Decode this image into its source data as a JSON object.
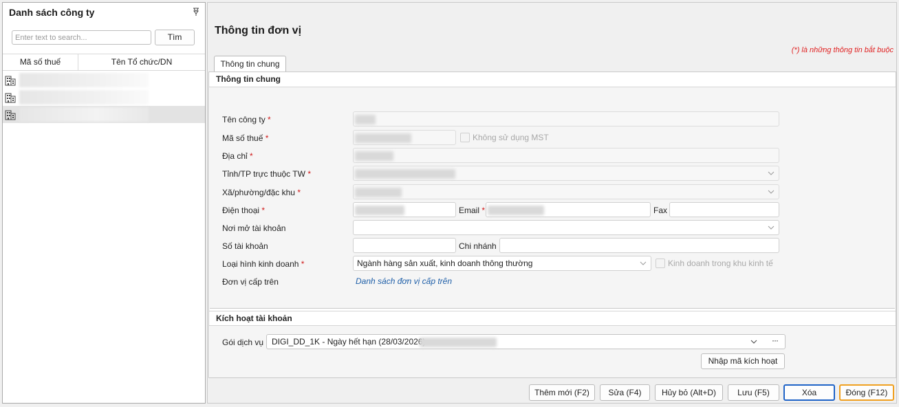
{
  "left_panel": {
    "title": "Danh sách công ty",
    "search": {
      "placeholder": "Enter text to search...",
      "value": ""
    },
    "search_button": "Tìm",
    "columns": [
      "Mã số thuế",
      "Tên Tổ chức/DN"
    ],
    "rows": [
      {
        "icon": "building-icon"
      },
      {
        "icon": "building-icon"
      },
      {
        "icon": "building-icon"
      }
    ]
  },
  "main": {
    "title": "Thông tin đơn vị",
    "required_note": "(*) là những thông tin bắt buộc",
    "tab": "Thông tin chung",
    "section_general": "Thông tin chung",
    "section_activation": "Kích hoạt tài khoản",
    "fields": {
      "company_name": {
        "label": "Tên công ty",
        "required": "*"
      },
      "tax_code": {
        "label": "Mã số thuế",
        "required": "*"
      },
      "no_tax_code": {
        "label": "Không sử dụng MST",
        "checked": false
      },
      "address": {
        "label": "Địa chỉ",
        "required": "*"
      },
      "province": {
        "label": "Tỉnh/TP trực thuộc TW",
        "required": "*"
      },
      "ward": {
        "label": "Xã/phường/đặc khu",
        "required": "*"
      },
      "phone": {
        "label": "Điện thoại",
        "required": "*"
      },
      "email": {
        "label": "Email",
        "required": "*"
      },
      "fax": {
        "label": "Fax",
        "value": ""
      },
      "bank": {
        "label": "Nơi mở tài khoản",
        "value": ""
      },
      "account_no": {
        "label": "Số tài khoản",
        "value": ""
      },
      "branch": {
        "label": "Chi nhánh",
        "value": ""
      },
      "business_type": {
        "label": "Loại hình kinh doanh",
        "required": "*",
        "value": "Ngành hàng sản xuất, kinh doanh thông thường"
      },
      "economic_zone": {
        "label": "Kinh doanh trong khu kinh tế",
        "checked": false
      },
      "parent_unit": {
        "label": "Đơn vị cấp trên",
        "link": "Danh sách đơn vị cấp trên"
      }
    },
    "activation": {
      "package_label": "Gói dịch vụ",
      "package_value": "DIGI_DD_1K - Ngày hết hạn (28/03/2026) -",
      "more_button": "···",
      "activate_button": "Nhập mã kích hoạt"
    }
  },
  "buttons": {
    "add": "Thêm mới (F2)",
    "edit": "Sửa (F4)",
    "cancel": "Hủy bỏ (Alt+D)",
    "save": "Lưu (F5)",
    "delete": "Xóa",
    "close": "Đóng (F12)"
  },
  "colors": {
    "required": "#d01818",
    "link": "#1f5fa8",
    "focus_blue": "#1e63c7",
    "focus_orange": "#f0a020"
  }
}
